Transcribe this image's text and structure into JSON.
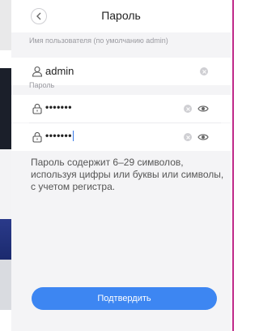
{
  "header": {
    "title": "Пароль"
  },
  "username": {
    "label": "Имя пользователя (по умолчанию admin)",
    "value": "admin"
  },
  "password": {
    "label": "Пароль",
    "value_masked": "•••••••",
    "confirm_masked": "•••••••"
  },
  "hint": "Пароль содержит 6–29 символов, используя цифры или буквы или символы, с учетом регистра.",
  "confirm_button": "Подтвердить",
  "icons": {
    "back": "chevron-left-icon",
    "user": "user-icon",
    "lock": "lock-icon",
    "clear": "clear-icon",
    "eye": "eye-icon"
  },
  "colors": {
    "accent": "#3d86f2"
  }
}
